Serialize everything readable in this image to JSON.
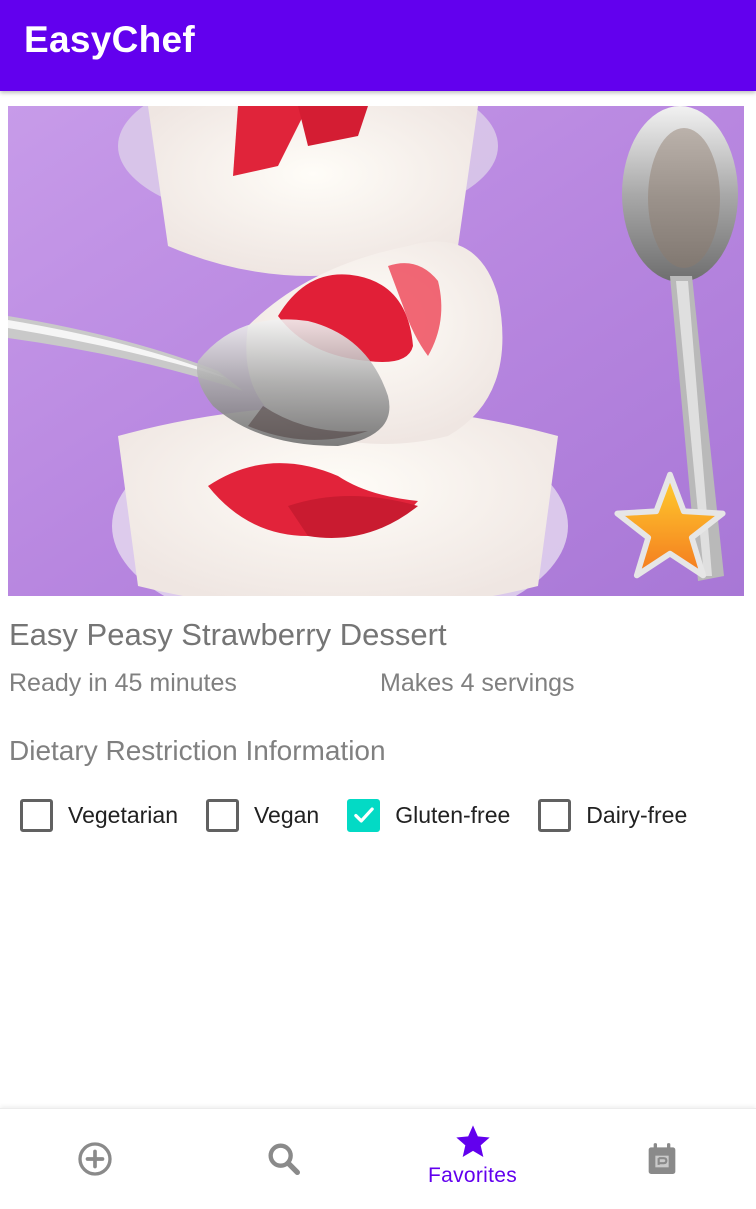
{
  "app_bar": {
    "title": "EasyChef"
  },
  "recipe": {
    "title": "Easy Peasy Strawberry Dessert",
    "ready_time": "Ready in 45 minutes",
    "servings": "Makes 4 servings",
    "is_favorite": true
  },
  "dietary": {
    "heading": "Dietary Restriction Information",
    "options": [
      {
        "label": "Vegetarian",
        "checked": false
      },
      {
        "label": "Vegan",
        "checked": false
      },
      {
        "label": "Gluten-free",
        "checked": true
      },
      {
        "label": "Dairy-free",
        "checked": false
      }
    ]
  },
  "bottom_nav": {
    "items": [
      {
        "icon": "add-circle-icon",
        "label": "",
        "active": false
      },
      {
        "icon": "search-icon",
        "label": "",
        "active": false
      },
      {
        "icon": "star-icon",
        "label": "Favorites",
        "active": true
      },
      {
        "icon": "planner-icon",
        "label": "",
        "active": false
      }
    ]
  },
  "colors": {
    "primary": "#6200ee",
    "checkbox_checked": "#03dac5",
    "inactive_icon": "#8a8a8a",
    "image_background": "#c493e6"
  }
}
